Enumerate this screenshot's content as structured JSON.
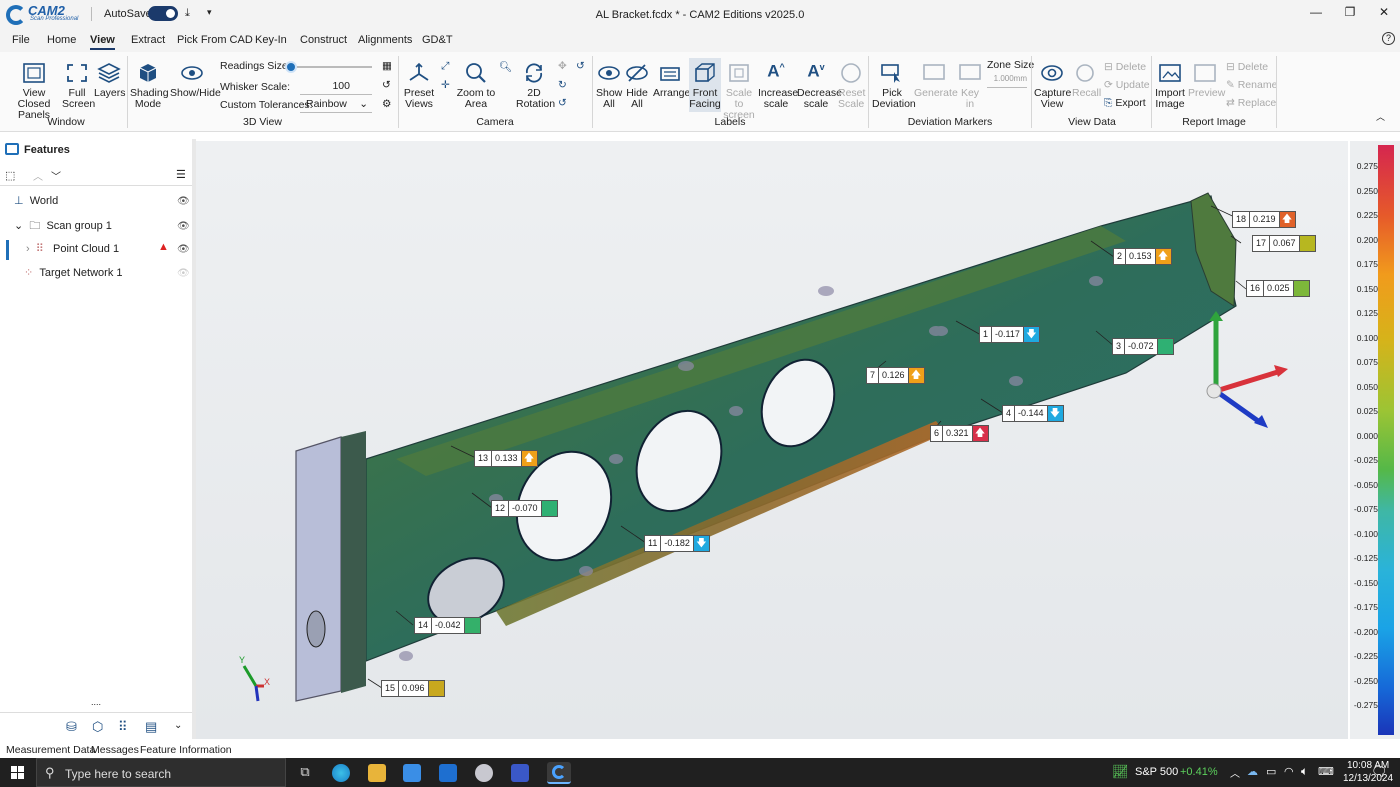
{
  "app": {
    "logo_main": "CAM2",
    "logo_sub": "Scan Professional",
    "autosave_label": "AutoSave",
    "document_title": "AL Bracket.fcdx * - CAM2 Editions v2025.0"
  },
  "menu": [
    "File",
    "Home",
    "View",
    "Extract",
    "Pick From CAD",
    "Key-In",
    "Construct",
    "Alignments",
    "GD&T"
  ],
  "ribbon": {
    "view_closed_panels": "View Closed Panels",
    "full_screen": "Full Screen",
    "layers": "Layers",
    "window_group": "Window",
    "shading_mode": "Shading Mode",
    "show_hide": "Show/Hide",
    "readings_size_label": "Readings Size:",
    "whisker_scale_label": "Whisker Scale:",
    "whisker_scale_value": "100",
    "custom_tolerances_label": "Custom Tolerances:",
    "custom_tolerances_value": "Rainbow",
    "view3d_group": "3D View",
    "preset_views": "Preset Views",
    "zoom_to_area": "Zoom to Area",
    "rotation_2d": "2D Rotation",
    "camera_group": "Camera",
    "show_all": "Show All",
    "hide_all": "Hide All",
    "arrange": "Arrange",
    "front_facing": "Front Facing",
    "scale_to_screen": "Scale to screen",
    "increase_scale": "Increase scale",
    "decrease_scale": "Decrease scale",
    "reset_scale": "Reset Scale",
    "labels_group": "Labels",
    "pick_deviation": "Pick Deviation",
    "generate": "Generate",
    "key_in": "Key in",
    "zone_size_label": "Zone Size",
    "zone_size_value": "1.000mm",
    "deviation_group": "Deviation Markers",
    "capture_view": "Capture View",
    "recall": "Recall",
    "delete": "Delete",
    "update": "Update",
    "export": "Export",
    "view_data_group": "View Data",
    "import_image": "Import Image",
    "preview": "Preview",
    "delete2": "Delete",
    "rename": "Rename",
    "replace": "Replace",
    "report_group": "Report Image"
  },
  "features": {
    "title": "Features",
    "items": [
      {
        "label": "World"
      },
      {
        "label": "Scan group 1"
      },
      {
        "label": "Point Cloud 1"
      },
      {
        "label": "Target Network 1"
      }
    ]
  },
  "scale": {
    "ticks": [
      "0.275",
      "0.250",
      "0.225",
      "0.200",
      "0.175",
      "0.150",
      "0.125",
      "0.100",
      "0.075",
      "0.050",
      "0.025",
      "0.000",
      "-0.025",
      "-0.050",
      "-0.075",
      "-0.100",
      "-0.125",
      "-0.150",
      "-0.175",
      "-0.200",
      "-0.225",
      "-0.250",
      "-0.275"
    ]
  },
  "markers": [
    {
      "num": "18",
      "val": "0.219",
      "color": "#e0622a",
      "dir": "up"
    },
    {
      "num": "17",
      "val": "0.067",
      "color": "#b7b720",
      "dir": ""
    },
    {
      "num": "2",
      "val": "0.153",
      "color": "#f0a019",
      "dir": "up"
    },
    {
      "num": "16",
      "val": "0.025",
      "color": "#7db73a",
      "dir": ""
    },
    {
      "num": "1",
      "val": "-0.117",
      "color": "#1fa9e0",
      "dir": "down"
    },
    {
      "num": "3",
      "val": "-0.072",
      "color": "#2fb073",
      "dir": ""
    },
    {
      "num": "7",
      "val": "0.126",
      "color": "#f0a019",
      "dir": "up"
    },
    {
      "num": "4",
      "val": "-0.144",
      "color": "#1fa9e0",
      "dir": "down"
    },
    {
      "num": "6",
      "val": "0.321",
      "color": "#d8304a",
      "dir": "up"
    },
    {
      "num": "13",
      "val": "0.133",
      "color": "#f0a019",
      "dir": "up"
    },
    {
      "num": "12",
      "val": "-0.070",
      "color": "#2fb073",
      "dir": ""
    },
    {
      "num": "11",
      "val": "-0.182",
      "color": "#1fa9e0",
      "dir": "down"
    },
    {
      "num": "14",
      "val": "-0.042",
      "color": "#34b06a",
      "dir": ""
    },
    {
      "num": "15",
      "val": "0.096",
      "color": "#c8a81e",
      "dir": ""
    }
  ],
  "bottom_tabs": [
    "Measurement Data",
    "Messages",
    "Feature Information"
  ],
  "taskbar": {
    "search_placeholder": "Type here to search",
    "stock_label": "S&P 500",
    "stock_change": "+0.41%",
    "time": "10:08 AM",
    "date": "12/13/2024"
  }
}
